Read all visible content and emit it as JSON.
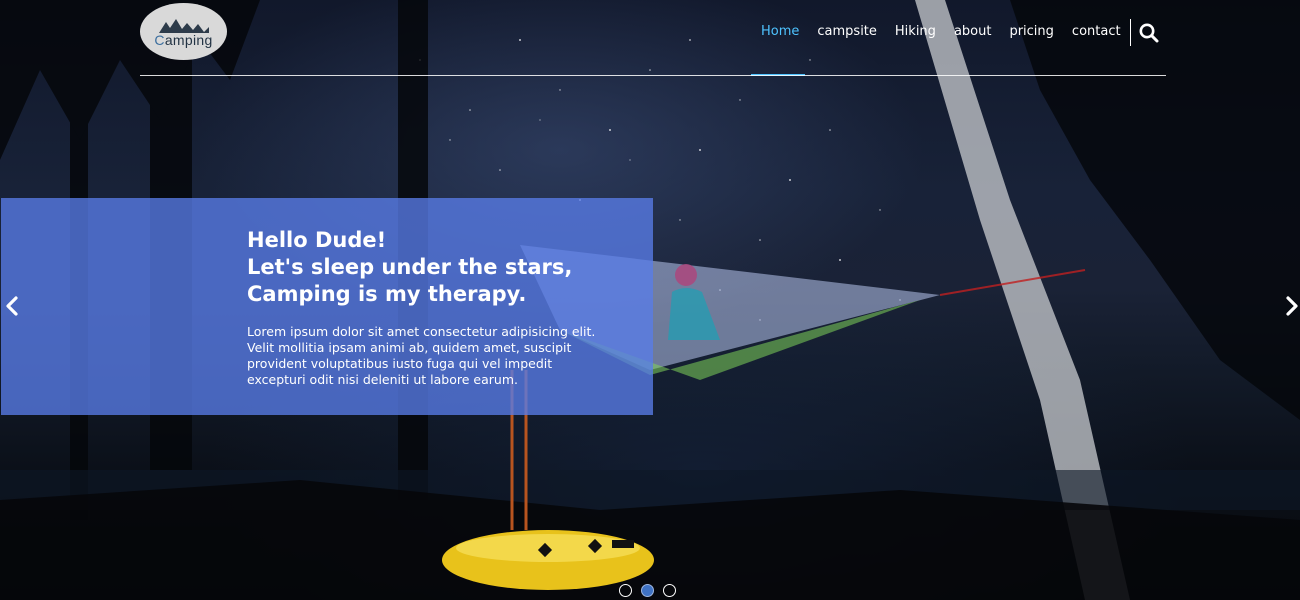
{
  "brand": {
    "logo_text": "Camping",
    "logo_text_first": "C",
    "logo_text_rest": "amping"
  },
  "nav": {
    "items": [
      {
        "label": "Home",
        "active": true
      },
      {
        "label": "campsite",
        "active": false
      },
      {
        "label": "Hiking",
        "active": false
      },
      {
        "label": "about",
        "active": false
      },
      {
        "label": "pricing",
        "active": false
      },
      {
        "label": "contact",
        "active": false
      }
    ],
    "search_icon": "search-icon"
  },
  "slider": {
    "heading": {
      "line1": "Hello Dude!",
      "line2": "Let's sleep under the stars,",
      "line3": "Camping is my therapy."
    },
    "body": {
      "line1": "Lorem ipsum dolor sit amet consectetur adipisicing elit.",
      "line2": "Velit mollitia ipsam animi ab, quidem amet, suscipit",
      "line3": "provident voluptatibus iusto fuga qui vel impedit",
      "line4": "excepturi odit nisi deleniti ut labore earum."
    },
    "prev_icon": "chevron-left-icon",
    "next_icon": "chevron-right-icon",
    "slide_count": 3,
    "active_slide": 2
  },
  "colors": {
    "accent": "#4ec3ff",
    "caption_bg": "#587ce8",
    "active_dot": "#3f72c4"
  }
}
